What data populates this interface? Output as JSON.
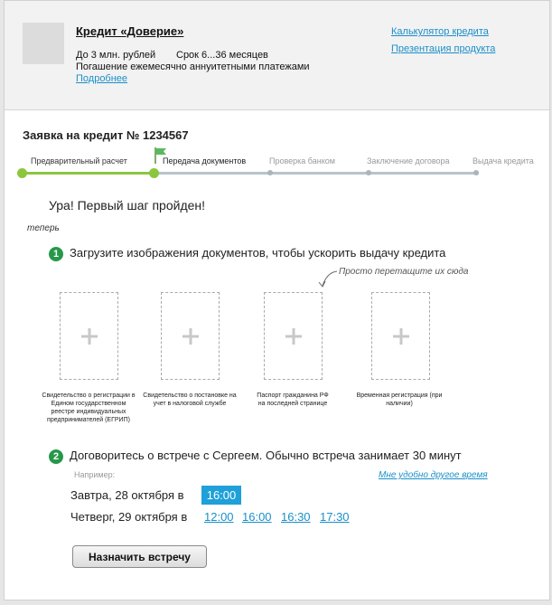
{
  "product": {
    "title": "Кредит «Доверие»",
    "amount": "До 3 млн. рублей",
    "term": "Срок 6...36 месяцев",
    "repayment": "Погашение ежемесячно аннуитетными платежами",
    "more_link": "Подробнее",
    "links": [
      "Калькулятор кредита",
      "Презентация продукта"
    ]
  },
  "application": {
    "title": "Заявка на кредит № 1234567"
  },
  "progress": {
    "steps": [
      "Предварительный расчет",
      "Передача документов",
      "Проверка банком",
      "Заключение договора",
      "Выдача кредита"
    ],
    "current_index": 1,
    "colors": {
      "done": "#8cc63f",
      "pending": "#b8c4cc",
      "flag": "#5cb85c"
    }
  },
  "message": {
    "hooray": "Ура! Первый шаг пройден!",
    "now": "теперь"
  },
  "step1": {
    "number": "1",
    "text": "Загрузите изображения документов, чтобы ускорить выдачу кредита",
    "hint": "Просто перетащите их сюда",
    "documents": [
      "Свидетельство о регистрации в Едином государственном реестре индивидуальных предпринимателей (ЕГРИП)",
      "Свидетельство о постановке на учет в налоговой службе",
      "Паспорт гражданина РФ на последней странице",
      "Временная регистрация (при наличии)"
    ]
  },
  "step2": {
    "number": "2",
    "text": "Договоритесь о встрече с Сергеем. Обычно встреча занимает 30 минут",
    "example": "Например:",
    "other_time": "Мне удобно другое время",
    "day1": {
      "label": "Завтра, 28 октября в",
      "selected_time": "16:00"
    },
    "day2": {
      "label": "Четверг, 29 октября в",
      "times": [
        "12:00",
        "16:00",
        "16:30",
        "17:30"
      ]
    },
    "button": "Назначить встречу"
  }
}
